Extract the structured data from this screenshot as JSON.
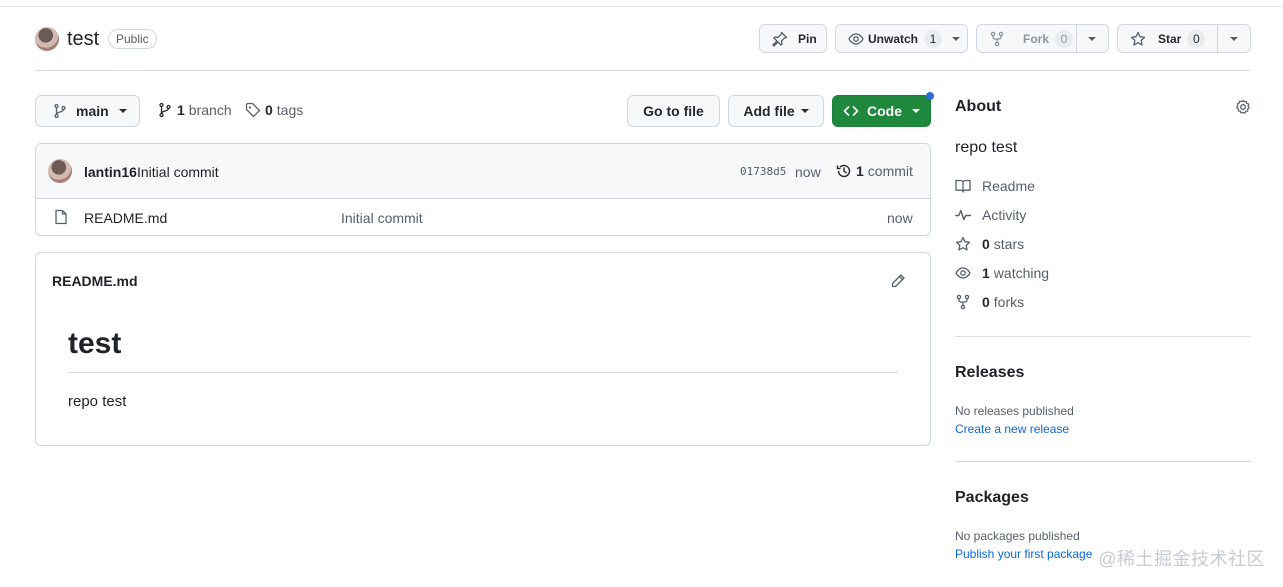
{
  "header": {
    "repo_name": "test",
    "visibility": "Public",
    "pin_label": "Pin",
    "unwatch_label": "Unwatch",
    "watch_count": "1",
    "fork_label": "Fork",
    "fork_count": "0",
    "star_label": "Star",
    "star_count": "0"
  },
  "toolbar": {
    "branch": "main",
    "branch_count": "1",
    "branch_label": "branch",
    "tag_count": "0",
    "tag_label": "tags",
    "go_to_file": "Go to file",
    "add_file": "Add file",
    "code": "Code"
  },
  "commit": {
    "author": "lantin16",
    "message": "Initial commit",
    "sha": "01738d5",
    "time": "now",
    "count": "1",
    "count_label": "commit"
  },
  "files": [
    {
      "name": "README.md",
      "message": "Initial commit",
      "time": "now"
    }
  ],
  "readme": {
    "filename": "README.md",
    "heading": "test",
    "body": "repo test"
  },
  "about": {
    "title": "About",
    "description": "repo test",
    "readme_label": "Readme",
    "activity_label": "Activity",
    "stars_count": "0",
    "stars_label": "stars",
    "watching_count": "1",
    "watching_label": "watching",
    "forks_count": "0",
    "forks_label": "forks"
  },
  "releases": {
    "title": "Releases",
    "empty": "No releases published",
    "create_link": "Create a new release"
  },
  "packages": {
    "title": "Packages",
    "empty": "No packages published",
    "publish_link": "Publish your first package"
  },
  "watermark": "@稀土掘金技术社区",
  "colors": {
    "code_button": "#1f883d",
    "link": "#0969da",
    "border": "#d0d7de",
    "notification_dot": "#2f6bd8"
  }
}
